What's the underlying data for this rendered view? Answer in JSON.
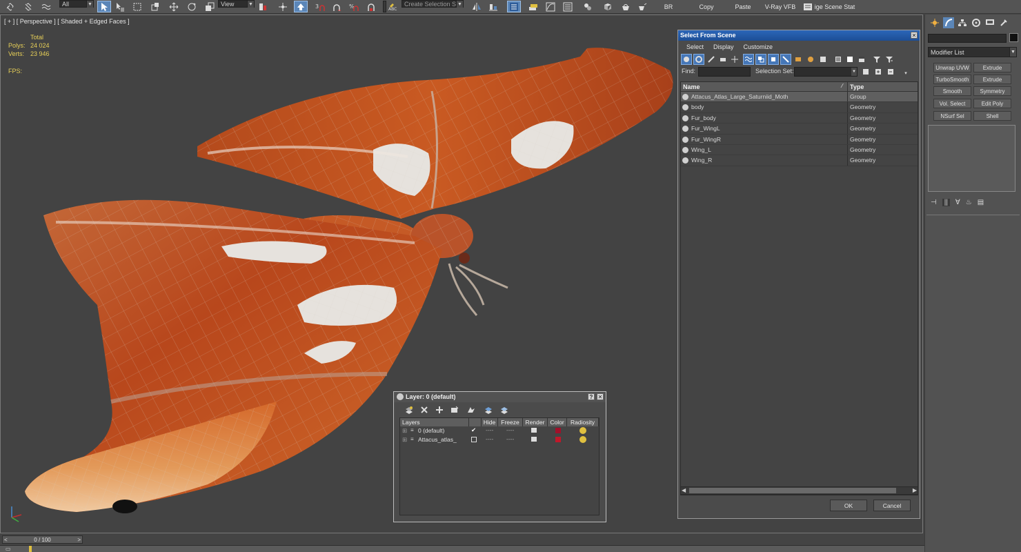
{
  "toolbar": {
    "selection_filter": "All",
    "reference_coord": "View",
    "named_selection_placeholder": "Create Selection Se",
    "br_label": "BR",
    "copy_label": "Copy",
    "paste_label": "Paste",
    "vray_label": "V-Ray VFB",
    "scene_states_label": "ige Scene Stat"
  },
  "viewport": {
    "label": "[ + ] [ Perspective ] [ Shaded + Edged Faces ]",
    "stats": {
      "total_label": "Total",
      "polys_label": "Polys:",
      "polys_value": "24 024",
      "verts_label": "Verts:",
      "verts_value": "23 946",
      "fps_label": "FPS:"
    }
  },
  "command_panel": {
    "modifier_list": "Modifier List",
    "buttons": [
      "Unwrap UVW",
      "Extrude",
      "TurboSmooth",
      "Extrude",
      "Smooth",
      "Symmetry",
      "Vol. Select",
      "Edit Poly",
      "NSurf Sel",
      "Shell"
    ]
  },
  "select_from_scene": {
    "title": "Select From Scene",
    "menu": [
      "Select",
      "Display",
      "Customize"
    ],
    "find_label": "Find:",
    "selection_set_label": "Selection Set:",
    "columns": {
      "name": "Name",
      "type": "Type"
    },
    "rows": [
      {
        "name": "Attacus_Atlas_Large_Saturniid_Moth",
        "type": "Group"
      },
      {
        "name": "body",
        "type": "Geometry"
      },
      {
        "name": "Fur_body",
        "type": "Geometry"
      },
      {
        "name": "Fur_WingL",
        "type": "Geometry"
      },
      {
        "name": "Fur_WingR",
        "type": "Geometry"
      },
      {
        "name": "Wing_L",
        "type": "Geometry"
      },
      {
        "name": "Wing_R",
        "type": "Geometry"
      }
    ],
    "ok_label": "OK",
    "cancel_label": "Cancel"
  },
  "layer_dialog": {
    "title": "Layer: 0 (default)",
    "help_label": "?",
    "columns": [
      "Layers",
      "Hide",
      "Freeze",
      "Render",
      "Color",
      "Radiosity"
    ],
    "rows": [
      {
        "name": "0 (default)",
        "hide": "----",
        "freeze": "----",
        "color": "#a0102a"
      },
      {
        "name": "Attacus_atlas_",
        "hide": "----",
        "freeze": "----",
        "color": "#c0182a"
      }
    ]
  },
  "timeline": {
    "frame": "0 / 100",
    "prev": "<",
    "next": ">"
  }
}
